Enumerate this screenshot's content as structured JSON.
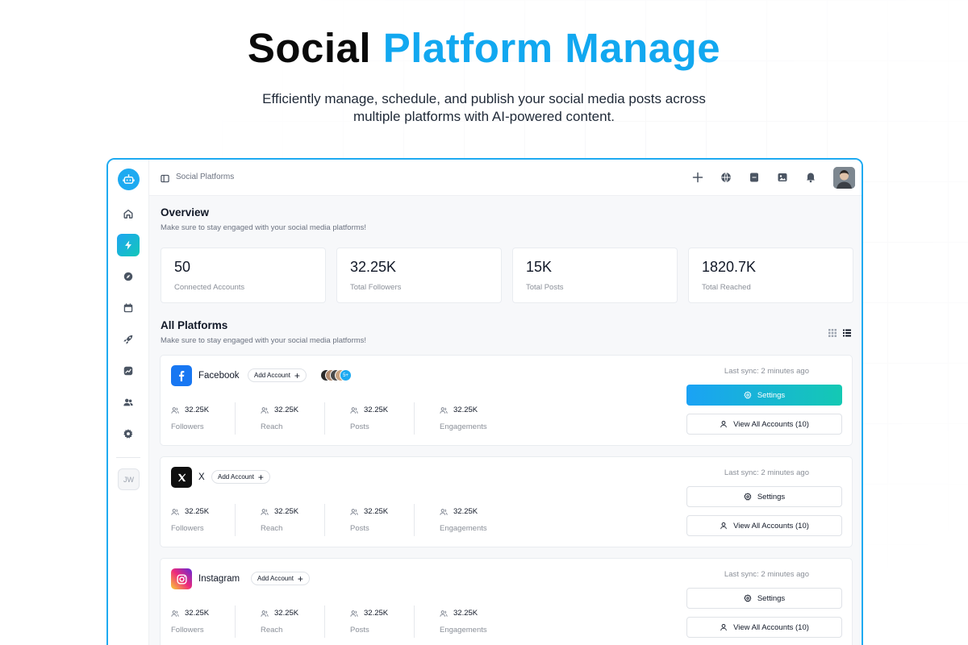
{
  "hero": {
    "title_part1": "Social",
    "title_part2": "Platform Manage",
    "subtitle_line1": "Efficiently manage, schedule, and publish your social media posts across",
    "subtitle_line2": "multiple platforms with AI-powered content."
  },
  "colors": {
    "accent": "#1eaaf1",
    "accent_gradient_end": "#14c9b3",
    "facebook": "#1877f2",
    "x": "#0f0f0f"
  },
  "sidebar": {
    "logo_icon": "robot-icon",
    "items": [
      {
        "name": "home",
        "icon": "home-icon",
        "active": false
      },
      {
        "name": "social-platforms",
        "icon": "lightning-icon",
        "active": true
      },
      {
        "name": "explore",
        "icon": "compass-icon",
        "active": false
      },
      {
        "name": "calendar",
        "icon": "calendar-icon",
        "active": false
      },
      {
        "name": "launch",
        "icon": "rocket-icon",
        "active": false
      },
      {
        "name": "analytics",
        "icon": "chart-icon",
        "active": false
      },
      {
        "name": "team",
        "icon": "users-icon",
        "active": false
      },
      {
        "name": "settings",
        "icon": "gear-icon",
        "active": false
      }
    ],
    "user_initials": "JW"
  },
  "topbar": {
    "breadcrumb": "Social Platforms",
    "icons": [
      "plus-icon",
      "globe-icon",
      "document-icon",
      "image-icon",
      "bell-icon"
    ]
  },
  "overview": {
    "title": "Overview",
    "subtitle": "Make sure to stay engaged with your social media platforms!",
    "stats": [
      {
        "value": "50",
        "label": "Connected Accounts"
      },
      {
        "value": "32.25K",
        "label": "Total Followers"
      },
      {
        "value": "15K",
        "label": "Total Posts"
      },
      {
        "value": "1820.7K",
        "label": "Total Reached"
      }
    ]
  },
  "all_platforms": {
    "title": "All Platforms",
    "subtitle": "Make sure to stay engaged with your social media platforms!",
    "add_account_label": "Add Account",
    "settings_label": "Settings",
    "view_all_label": "View All Accounts (10)",
    "avatars_more": "5+",
    "platforms": [
      {
        "name": "Facebook",
        "sync": "Last sync: 2 minutes ago",
        "metrics": [
          {
            "value": "32.25K",
            "label": "Followers"
          },
          {
            "value": "32.25K",
            "label": "Reach"
          },
          {
            "value": "32.25K",
            "label": "Posts"
          },
          {
            "value": "32.25K",
            "label": "Engagements"
          }
        ]
      },
      {
        "name": "X",
        "sync": "Last sync: 2 minutes ago",
        "metrics": [
          {
            "value": "32.25K",
            "label": "Followers"
          },
          {
            "value": "32.25K",
            "label": "Reach"
          },
          {
            "value": "32.25K",
            "label": "Posts"
          },
          {
            "value": "32.25K",
            "label": "Engagements"
          }
        ]
      },
      {
        "name": "Instagram",
        "sync": "Last sync: 2 minutes ago",
        "metrics": [
          {
            "value": "32.25K",
            "label": "Followers"
          },
          {
            "value": "32.25K",
            "label": "Reach"
          },
          {
            "value": "32.25K",
            "label": "Posts"
          },
          {
            "value": "32.25K",
            "label": "Engagements"
          }
        ]
      }
    ]
  }
}
